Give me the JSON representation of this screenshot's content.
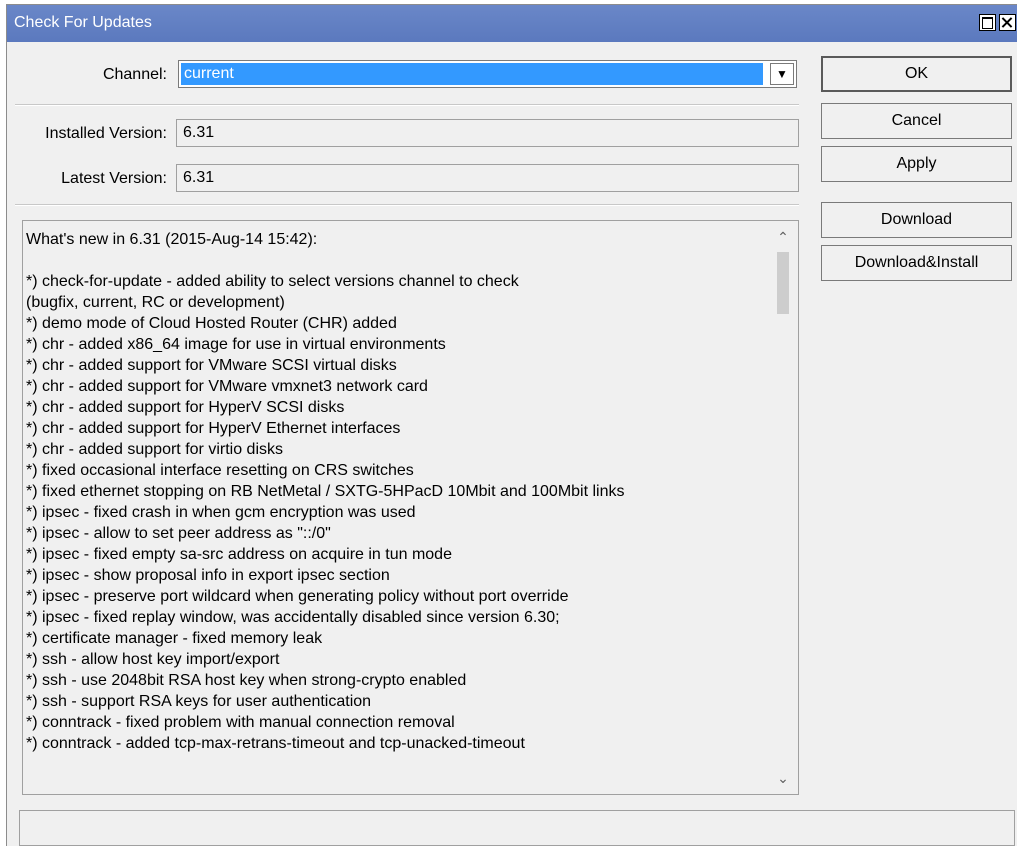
{
  "window": {
    "title": "Check For Updates"
  },
  "form": {
    "channel_label": "Channel:",
    "channel_value": "current",
    "installed_label": "Installed Version:",
    "installed_value": "6.31",
    "latest_label": "Latest Version:",
    "latest_value": "6.31"
  },
  "buttons": {
    "ok": "OK",
    "cancel": "Cancel",
    "apply": "Apply",
    "download": "Download",
    "download_install": "Download&Install"
  },
  "icons": {
    "dropdown": "dropdown-arrow-icon",
    "scroll_up": "scroll-up-icon",
    "scroll_down": "scroll-down-icon",
    "maximize": "maximize-icon",
    "close": "close-icon"
  },
  "colors": {
    "titlebar": "#5b79be",
    "selection": "#3399ff"
  },
  "notes": {
    "lines": [
      "What's new in 6.31 (2015-Aug-14 15:42):",
      "",
      "*) check-for-update - added ability to select versions channel to check",
      "(bugfix, current, RC or development)",
      "*) demo mode of Cloud Hosted Router (CHR) added",
      "*) chr - added x86_64 image for use in virtual environments",
      "*) chr - added support for VMware SCSI virtual disks",
      "*) chr - added support for VMware vmxnet3 network card",
      "*) chr - added support for HyperV SCSI disks",
      "*) chr - added support for HyperV Ethernet interfaces",
      "*) chr - added support for virtio disks",
      "*) fixed occasional interface resetting on CRS switches",
      "*) fixed ethernet stopping on RB NetMetal / SXTG-5HPacD 10Mbit and 100Mbit links",
      "*) ipsec - fixed crash in when gcm encryption was used",
      "*) ipsec - allow to set peer address as \"::/0\"",
      "*) ipsec - fixed empty sa-src address on acquire in tun mode",
      "*) ipsec - show proposal info in export ipsec section",
      "*) ipsec - preserve port wildcard when generating policy without port override",
      "*) ipsec - fixed replay window, was accidentally disabled since version 6.30;",
      "*) certificate manager - fixed memory leak",
      "*) ssh - allow host key import/export",
      "*) ssh - use 2048bit RSA host key when strong-crypto enabled",
      "*) ssh - support RSA keys for user authentication",
      "*) conntrack - fixed problem with manual connection removal",
      "*) conntrack - added tcp-max-retrans-timeout and tcp-unacked-timeout"
    ]
  },
  "status": {
    "text": ""
  }
}
